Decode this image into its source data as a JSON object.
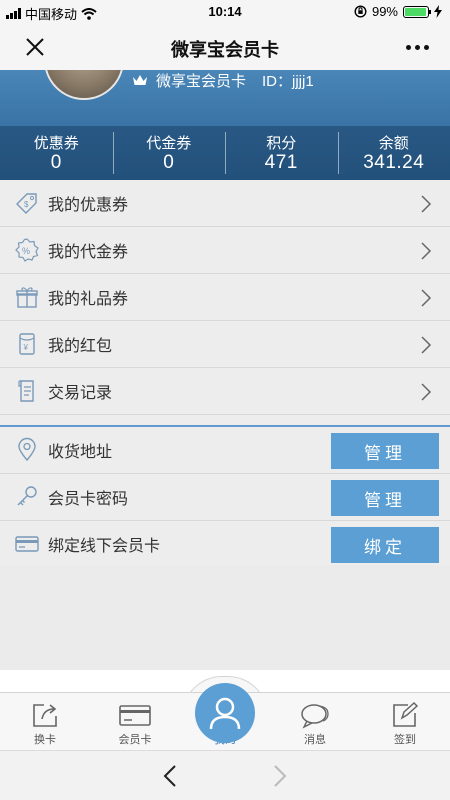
{
  "status_bar": {
    "carrier": "中国移动",
    "time": "10:14",
    "battery": "99%"
  },
  "nav": {
    "title": "微享宝会员卡"
  },
  "header": {
    "card_name": "微享宝会员卡",
    "id_text": "ID：jjjj1",
    "stats": [
      {
        "label": "优惠券",
        "value": "0"
      },
      {
        "label": "代金券",
        "value": "0"
      },
      {
        "label": "积分",
        "value": "471"
      },
      {
        "label": "余额",
        "value": "341.24"
      }
    ]
  },
  "menu": [
    {
      "label": "我的优惠券",
      "icon": "coupon-tag-icon"
    },
    {
      "label": "我的代金券",
      "icon": "percent-badge-icon"
    },
    {
      "label": "我的礼品券",
      "icon": "gift-icon"
    },
    {
      "label": "我的红包",
      "icon": "red-envelope-icon"
    },
    {
      "label": "交易记录",
      "icon": "receipt-icon"
    }
  ],
  "settings": [
    {
      "label": "收货地址",
      "action": "管理",
      "icon": "location-pin-icon"
    },
    {
      "label": "会员卡密码",
      "action": "管理",
      "icon": "key-icon"
    },
    {
      "label": "绑定线下会员卡",
      "action": "绑定",
      "icon": "card-icon"
    }
  ],
  "tabs": [
    {
      "label": "换卡",
      "icon": "share-icon"
    },
    {
      "label": "会员卡",
      "icon": "card-icon"
    },
    {
      "label": "我的",
      "icon": "user-icon",
      "active": true
    },
    {
      "label": "消息",
      "icon": "chat-icon"
    },
    {
      "label": "签到",
      "icon": "edit-icon"
    }
  ],
  "colors": {
    "accent": "#5c9fd4",
    "banner": "#3a73a6",
    "divider": "#5f9bd0"
  }
}
